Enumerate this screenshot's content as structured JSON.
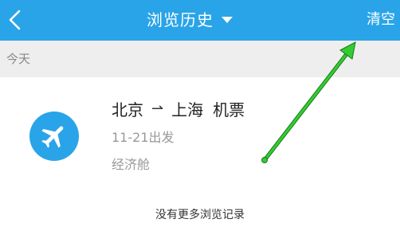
{
  "header": {
    "back_icon": "chevron-left-icon",
    "title": "浏览历史",
    "title_dropdown_icon": "caret-down-icon",
    "clear_label": "清空"
  },
  "section": {
    "label": "今天"
  },
  "history_items": [
    {
      "icon": "airplane-icon",
      "from": "北京",
      "route_arrow": "⇀",
      "to": "上海",
      "type": "机票",
      "depart": "11-21出发",
      "cabin": "经济舱"
    }
  ],
  "footer": {
    "no_more_text": "没有更多浏览记录"
  },
  "colors": {
    "accent": "#2aa4e8",
    "annotation_arrow": "#33cc33"
  }
}
